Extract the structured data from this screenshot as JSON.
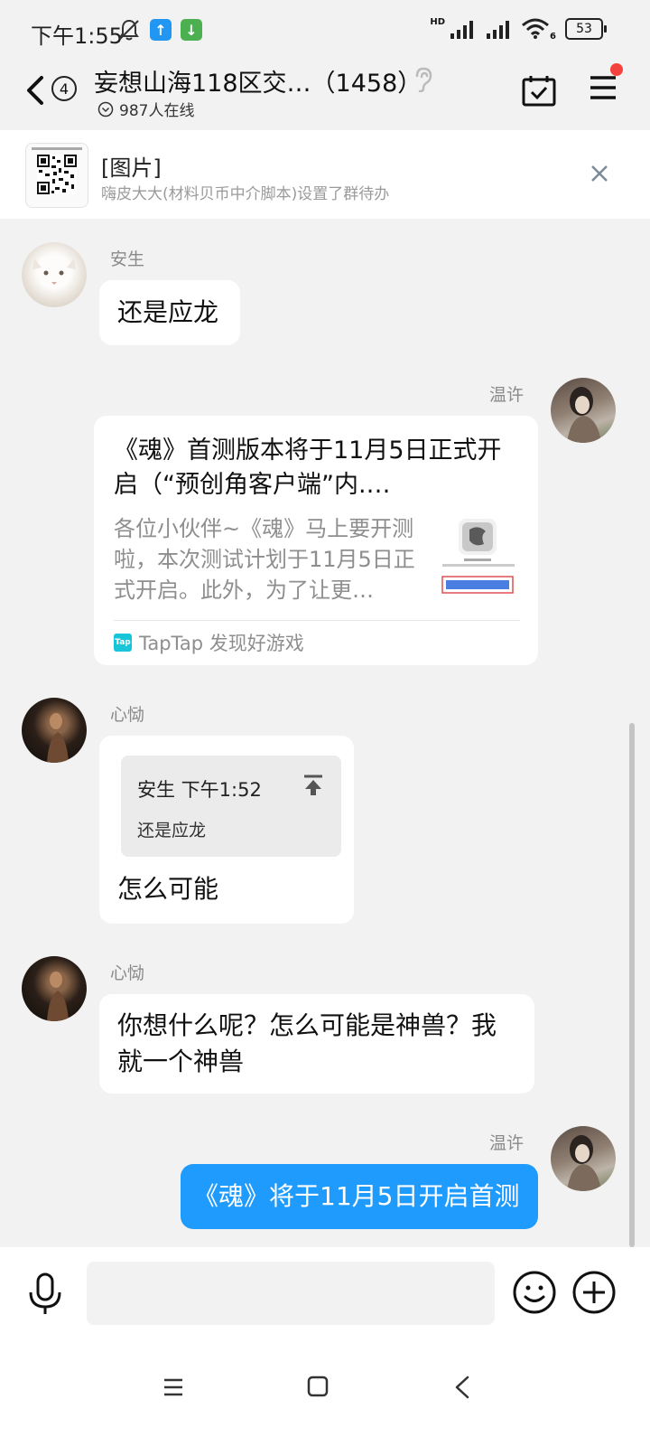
{
  "status_bar": {
    "time": "下午1:55",
    "battery": "53",
    "network_label": "HD",
    "wifi_label": "6"
  },
  "header": {
    "unread_count": "4",
    "title": "妄想山海118区交…（1458）",
    "online": "987人在线"
  },
  "todo_banner": {
    "title": "[图片]",
    "subtitle": "嗨皮大大(材料贝币中介脚本)设置了群待办"
  },
  "messages": [
    {
      "sender": "安生",
      "text": "还是应龙"
    },
    {
      "sender": "温许",
      "card_title": "《魂》首测版本将于11月5日正式开启（“预创角客户端”内.…",
      "card_desc": "各位小伙伴~《魂》马上要开测啦，本次测试计划于11月5日正式开启。此外，为了让更…",
      "card_source": "TapTap 发现好游戏",
      "source_icon_label": "Tap"
    },
    {
      "sender": "心恸",
      "quote_header": "安生 下午1:52",
      "quote_text": "还是应龙",
      "text": "怎么可能"
    },
    {
      "sender": "心恸",
      "text": "你想什么呢？怎么可能是神兽？我就一个神兽"
    },
    {
      "sender": "温许",
      "text": "《魂》将于11月5日开启首测"
    }
  ],
  "input": {
    "placeholder": ""
  },
  "colors": {
    "accent": "#1e9bfd",
    "background": "#f2f2f2",
    "notification_dot": "#f4433e",
    "status_upload": "#2196f3",
    "status_download": "#4caf50"
  }
}
